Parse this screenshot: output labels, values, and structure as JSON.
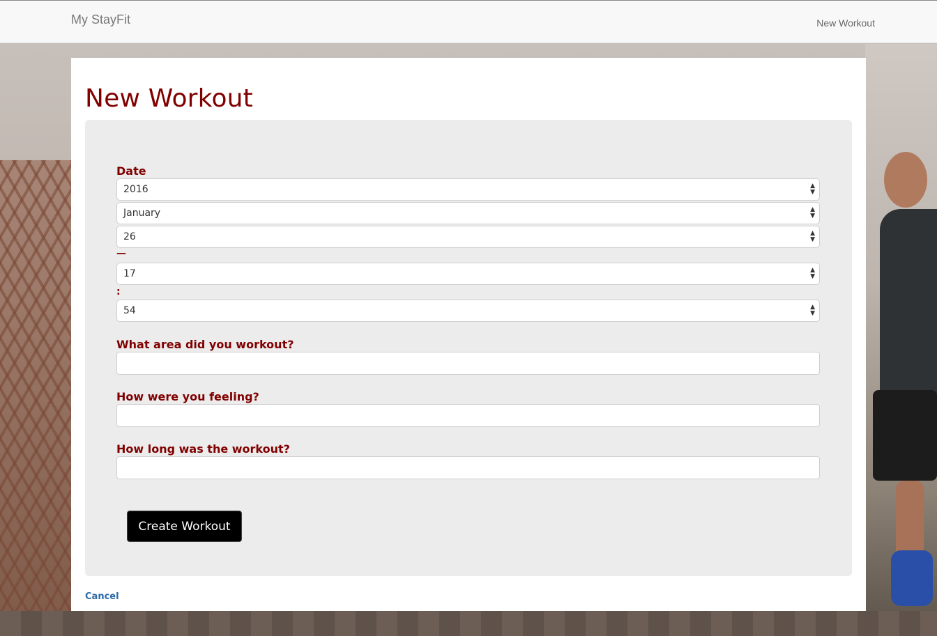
{
  "navbar": {
    "brand": "My StayFit",
    "new_workout_link": "New Workout"
  },
  "page": {
    "title": "New Workout"
  },
  "form": {
    "date_label": "Date",
    "year": "2016",
    "month": "January",
    "day": "26",
    "date_time_separator": "—",
    "hour": "17",
    "time_separator": ":",
    "minute": "54",
    "area_label": "What area did you workout?",
    "area_value": "",
    "feeling_label": "How were you feeling?",
    "feeling_value": "",
    "duration_label": "How long was the workout?",
    "duration_value": "",
    "submit_label": "Create Workout"
  },
  "cancel_label": "Cancel",
  "colors": {
    "accent": "#800000",
    "link": "#2d6aa8",
    "button_bg": "#000000",
    "panel_bg": "#ececec"
  },
  "icons": {
    "select_arrows": "select-arrows-icon"
  }
}
